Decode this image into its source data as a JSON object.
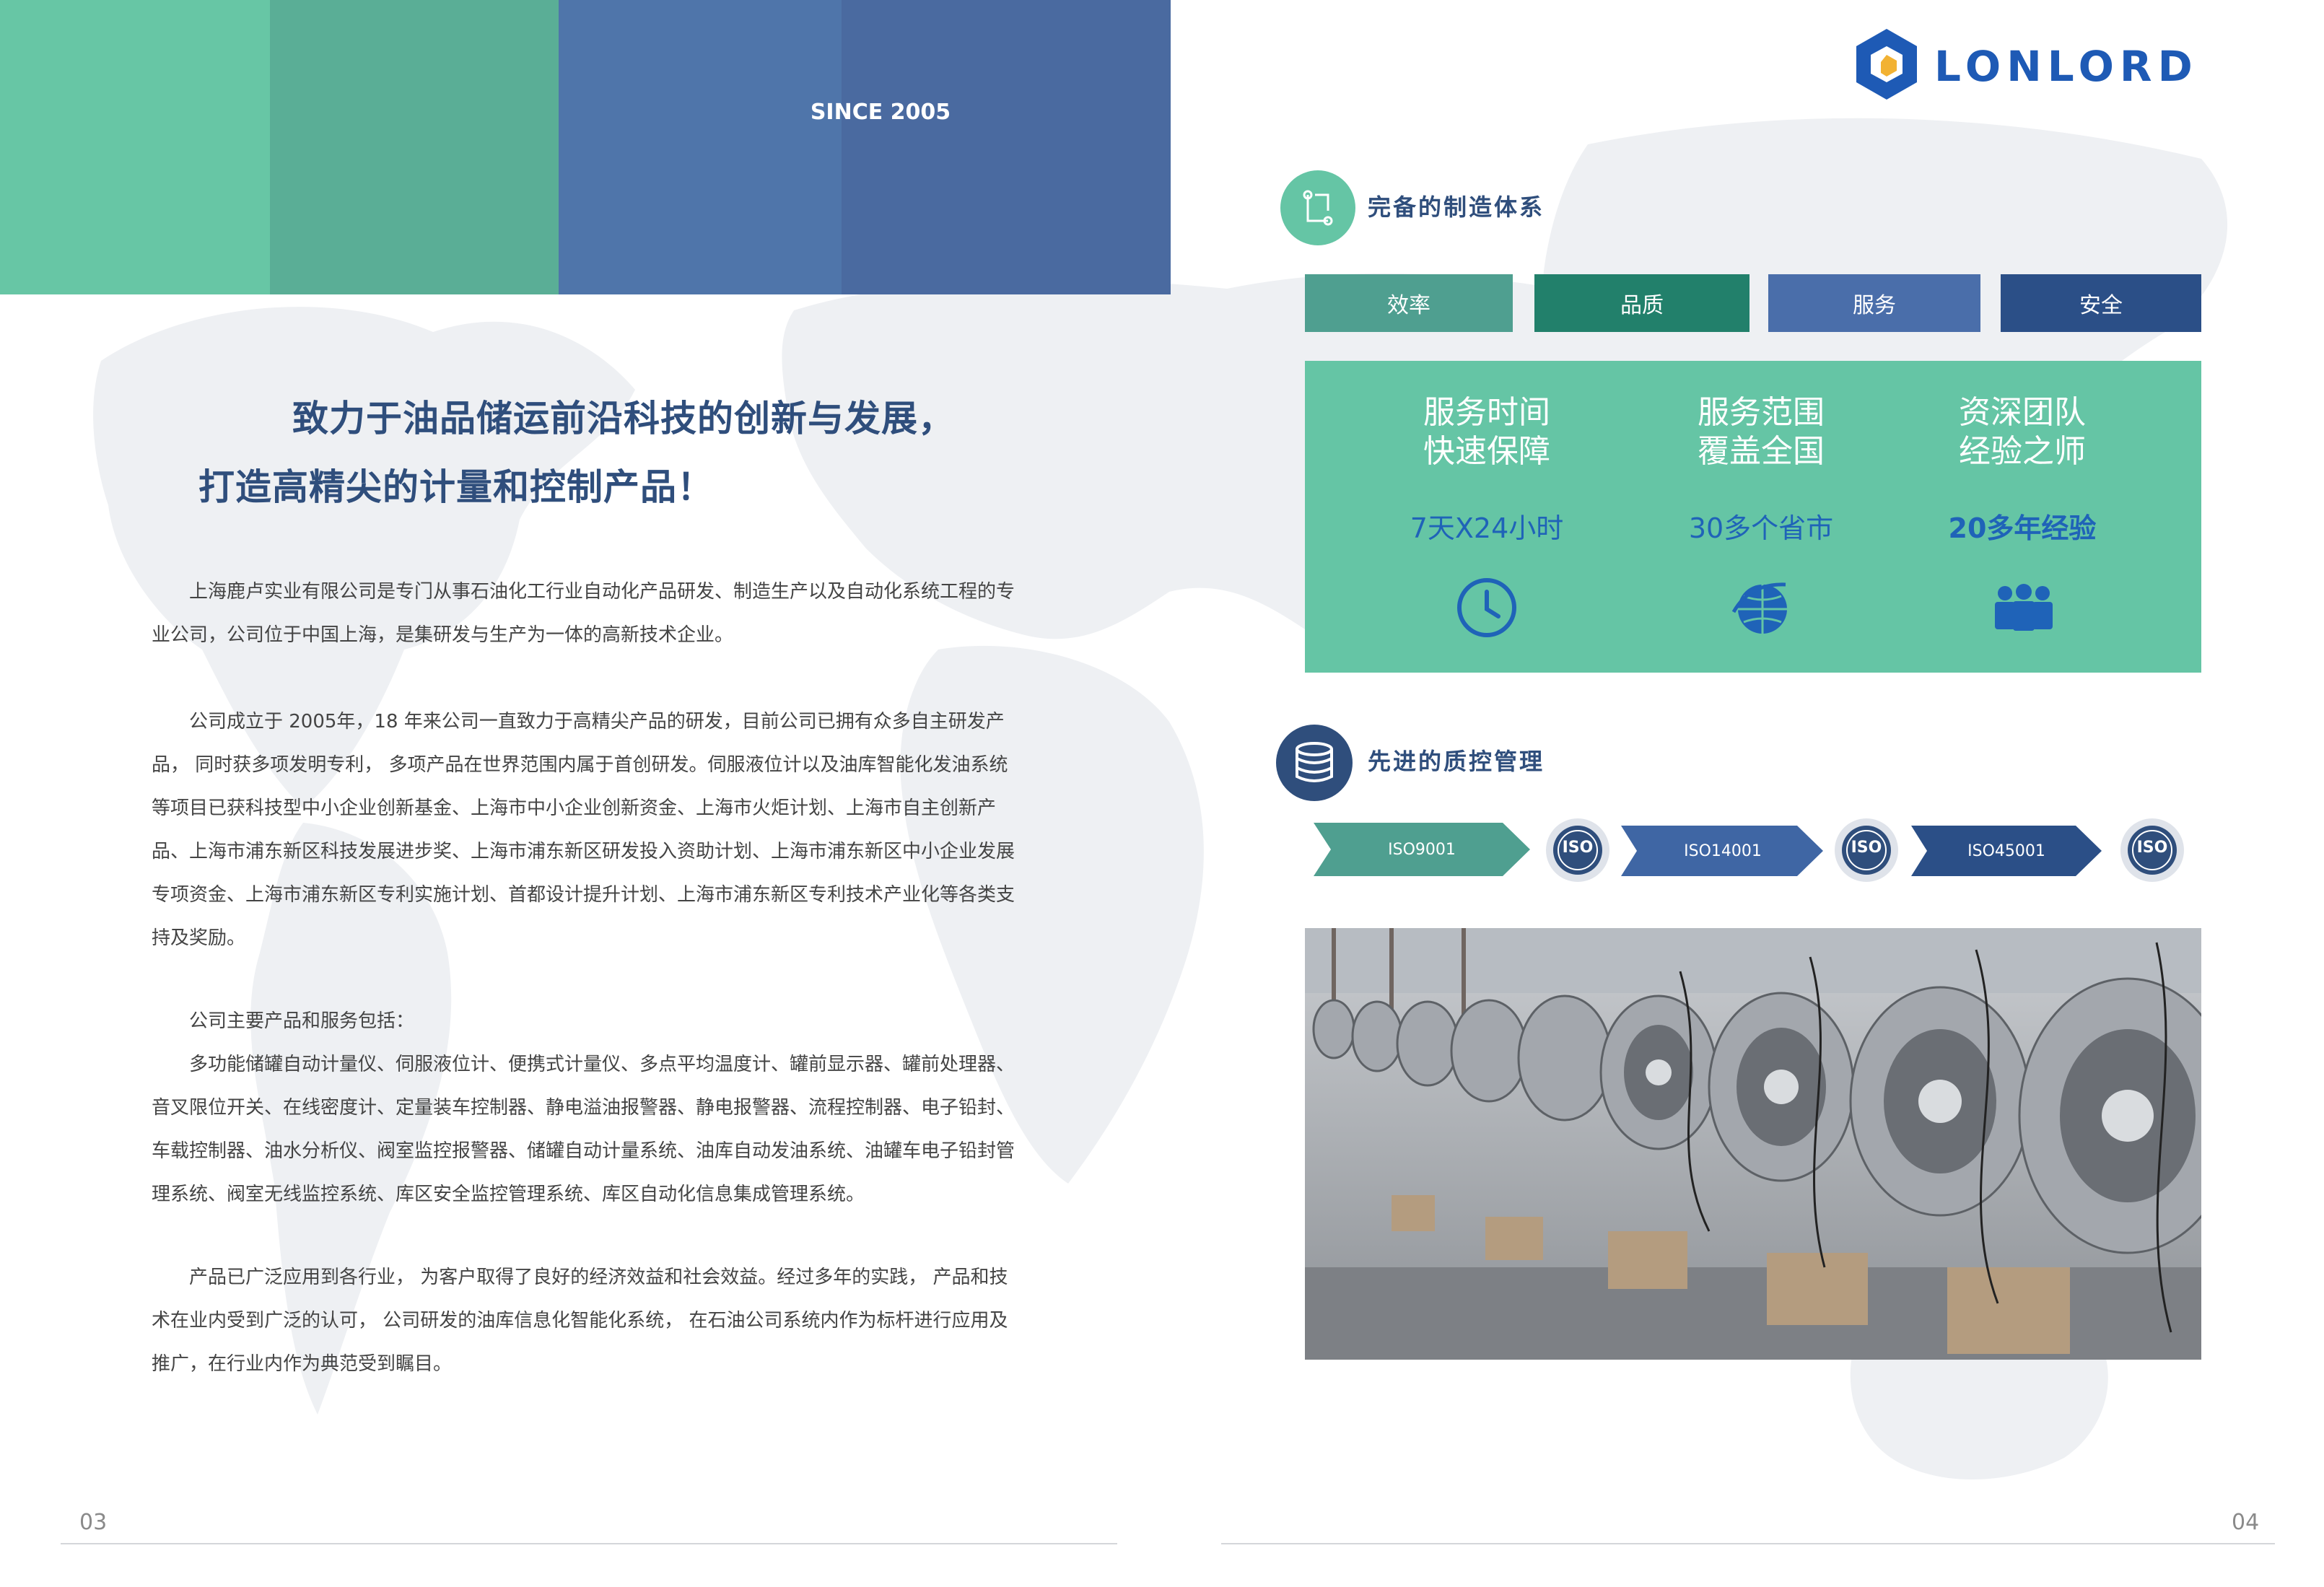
{
  "left_page": {
    "since": "SINCE 2005",
    "headline_line1": "致力于油品储运前沿科技的创新与发展，",
    "headline_line2": "打造高精尖的计量和控制产品！",
    "paragraphs": [
      "上海鹿卢实业有限公司是专门从事石油化工行业自动化产品研发、制造生产以及自动化系统工程的专业公司，公司位于中国上海，是集研发与生产为一体的高新技术企业。",
      "公司成立于 2005年，18 年来公司一直致力于高精尖产品的研发，目前公司已拥有众多自主研发产品， 同时获多项发明专利， 多项产品在世界范围内属于首创研发。伺服液位计以及油库智能化发油系统等项目已获科技型中小企业创新基金、上海市中小企业创新资金、上海市火炬计划、上海市自主创新产品、上海市浦东新区科技发展进步奖、上海市浦东新区研发投入资助计划、上海市浦东新区中小企业发展专项资金、上海市浦东新区专利实施计划、首都设计提升计划、上海市浦东新区专利技术产业化等各类支持及奖励。",
      "公司主要产品和服务包括：",
      "多功能储罐自动计量仪、伺服液位计、便携式计量仪、多点平均温度计、罐前显示器、罐前处理器、音叉限位开关、在线密度计、定量装车控制器、静电溢油报警器、静电报警器、流程控制器、电子铅封、车载控制器、油水分析仪、阀室监控报警器、储罐自动计量系统、油库自动发油系统、油罐车电子铅封管理系统、阀室无线监控系统、库区安全监控管理系统、库区自动化信息集成管理系统。",
      "产品已广泛应用到各行业， 为客户取得了良好的经济效益和社会效益。经过多年的实践， 产品和技术在业内受到广泛的认可， 公司研发的油库信息化智能化系统， 在石油公司系统内作为标杆进行应用及推广，在行业内作为典范受到瞩目。"
    ],
    "page_number": "03"
  },
  "right_page": {
    "logo": "LONLORD",
    "section1_title": "完备的制造体系",
    "tabs": [
      "效率",
      "品质",
      "服务",
      "安全"
    ],
    "features": [
      {
        "title_line1": "服务时间",
        "title_line2": "快速保障",
        "value": "7天X24小时",
        "icon": "clock-icon"
      },
      {
        "title_line1": "服务范围",
        "title_line2": "覆盖全国",
        "value": "30多个省市",
        "icon": "globe-icon"
      },
      {
        "title_line1": "资深团队",
        "title_line2": "经验之师",
        "value": "20多年经验",
        "icon": "team-icon"
      }
    ],
    "section2_title": "先进的质控管理",
    "certifications": [
      "ISO9001",
      "ISO14001",
      "ISO45001"
    ],
    "seal_text": "ISO",
    "page_number": "04"
  },
  "colors": {
    "band_green": "#67c6a5",
    "band_mid_green": "#5aae96",
    "band_blue": "#4f75aa",
    "band_dark_blue": "#4a6aa0",
    "heading_blue": "#2f4e7c",
    "logo_blue": "#1e5ab5",
    "tab_colors": [
      "#4f9f90",
      "#22806b",
      "#4a6eaa",
      "#2b4f87"
    ],
    "accent_teal": "#65c5a5"
  }
}
